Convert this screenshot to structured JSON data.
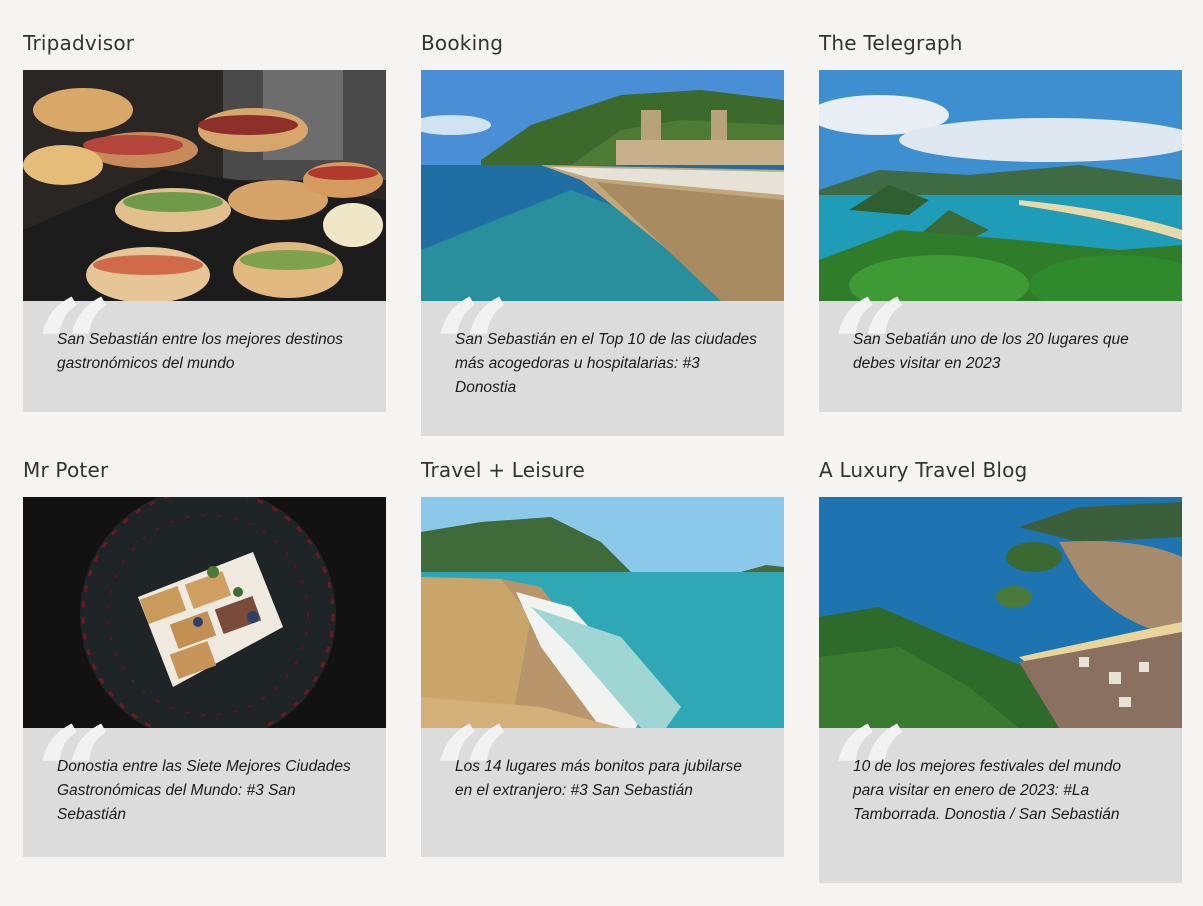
{
  "cards": [
    {
      "source": "Tripadvisor",
      "quote": "San Sebastián entre los mejores destinos gastronómicos del mundo",
      "image": "pintxos-food-photo"
    },
    {
      "source": "Booking",
      "quote": "San Sebastián en el Top 10 de las ciudades más acogedoras u hospitalarias: #3 Donostia",
      "image": "seafront-promenade-photo"
    },
    {
      "source": "The Telegraph",
      "quote": "San Sebatián uno de los 20 lugares que debes visitar en 2023",
      "image": "bay-aerial-photo"
    },
    {
      "source": "Mr Poter",
      "quote": "Donostia entre las Siete Mejores Ciudades Gastronómicas del Mundo: #3 San Sebastián",
      "image": "plated-dish-photo"
    },
    {
      "source": "Travel + Leisure",
      "quote": "Los 14 lugares más bonitos para jubilarse en el extranjero: #3 San Sebastián",
      "image": "beach-photo"
    },
    {
      "source": "A Luxury Travel Blog",
      "quote": "10 de los mejores festivales del mundo para visitar en enero de 2023: #La Tamborrada. Donostia / San Sebastián",
      "image": "city-aerial-photo"
    }
  ],
  "quote_glyph": "“"
}
